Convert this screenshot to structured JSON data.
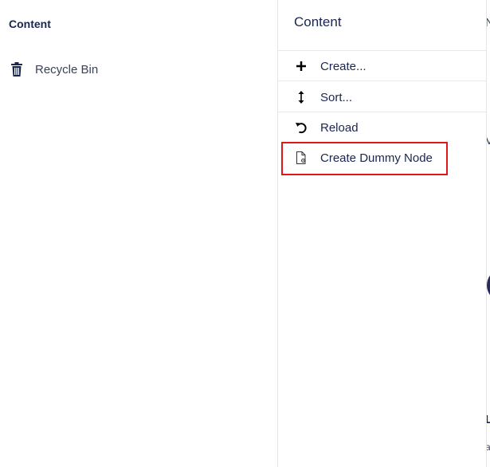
{
  "tree": {
    "title": "Content",
    "items": [
      {
        "label": "Recycle Bin",
        "icon": "trash-icon"
      }
    ]
  },
  "actions": {
    "title": "Content",
    "items": [
      {
        "label": "Create...",
        "icon": "plus-icon"
      },
      {
        "label": "Sort...",
        "icon": "sort-arrows-icon"
      },
      {
        "label": "Reload",
        "icon": "reload-icon"
      },
      {
        "label": "Create Dummy Node",
        "icon": "document-settings-icon"
      }
    ]
  },
  "background_fragments": {
    "frag1": "N",
    "frag2": "V",
    "frag3": "L",
    "frag4": "a"
  },
  "colors": {
    "highlight": "#e0161b",
    "text_primary": "#1b264f",
    "text_secondary": "#3a415a"
  }
}
